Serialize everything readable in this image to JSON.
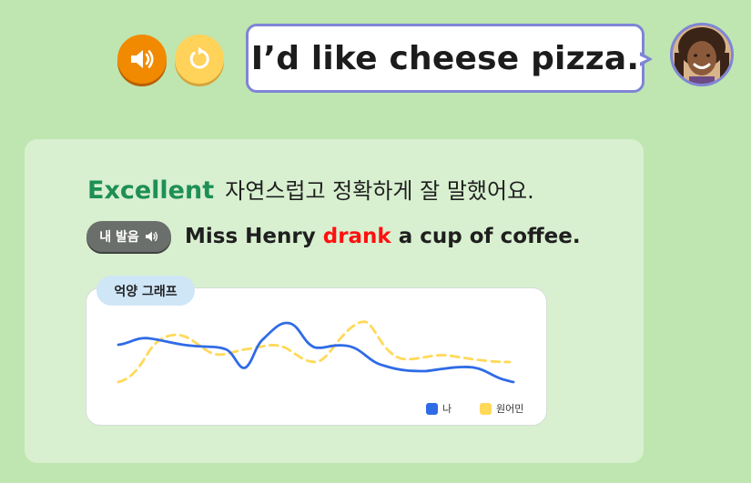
{
  "prompt": {
    "sentence": "I’d like cheese pizza."
  },
  "controls": {
    "audio_icon": "speaker-icon",
    "replay_icon": "replay-icon"
  },
  "feedback": {
    "rating": "Excellent",
    "message": "자연스럽고 정확하게 잘 말했어요.",
    "pronunciation_label": "내 발음",
    "sentence_before": "Miss Henry ",
    "sentence_highlight": "drank",
    "sentence_after": " a cup of coffee.",
    "highlight_color": "#ff1010"
  },
  "intonation_graph": {
    "tag": "억양 그래프",
    "legend": [
      {
        "label": "나",
        "color": "#2f6be6"
      },
      {
        "label": "원어민",
        "color": "#ffd95a"
      }
    ]
  },
  "colors": {
    "background": "#bfe6b0",
    "card": "#d8f0d0",
    "rating": "#1e8f55",
    "bubble_border": "#7f85d6"
  }
}
